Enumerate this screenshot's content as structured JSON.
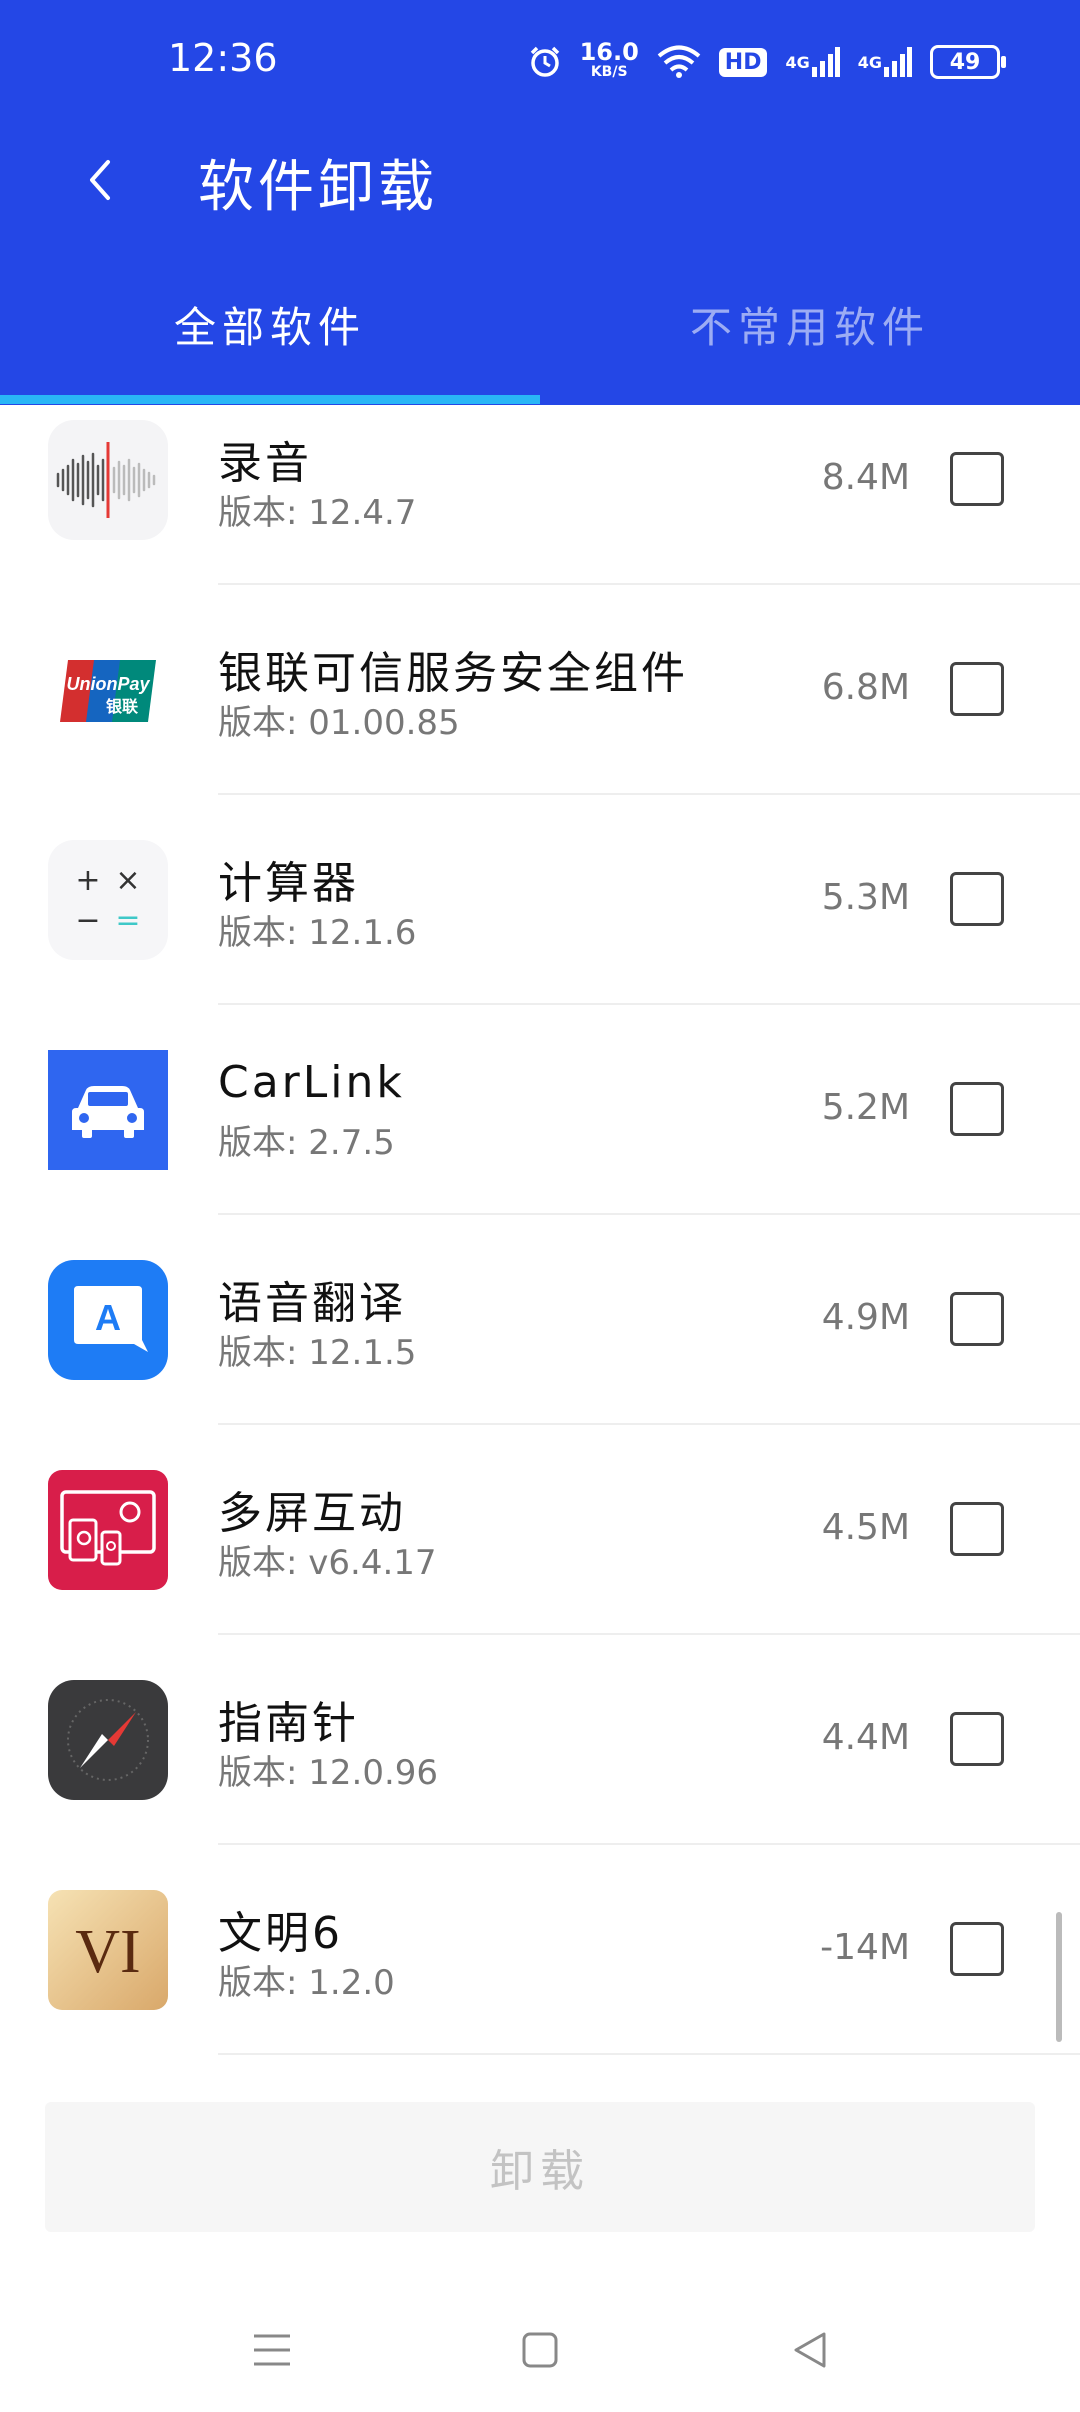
{
  "status_bar": {
    "time": "12:36",
    "speed_value": "16.0",
    "speed_unit": "KB/S",
    "hd_label": "HD",
    "net1": "4G",
    "net2": "4G",
    "battery": "49"
  },
  "header": {
    "title": "软件卸载",
    "back_icon": "chevron-left-icon"
  },
  "tabs": [
    {
      "label": "全部软件",
      "selected": true
    },
    {
      "label": "不常用软件",
      "selected": false
    }
  ],
  "apps": [
    {
      "name": "录音",
      "version": "版本: 12.4.7",
      "size": "8.4M",
      "icon": "recorder-icon",
      "checked": false
    },
    {
      "name": "银联可信服务安全组件",
      "version": "版本: 01.00.85",
      "size": "6.8M",
      "icon": "unionpay-icon",
      "checked": false
    },
    {
      "name": "计算器",
      "version": "版本: 12.1.6",
      "size": "5.3M",
      "icon": "calculator-icon",
      "checked": false
    },
    {
      "name": "CarLink",
      "version": "版本: 2.7.5",
      "size": "5.2M",
      "icon": "car-icon",
      "checked": false
    },
    {
      "name": "语音翻译",
      "version": "版本: 12.1.5",
      "size": "4.9M",
      "icon": "translate-icon",
      "checked": false
    },
    {
      "name": "多屏互动",
      "version": "版本: v6.4.17",
      "size": "4.5M",
      "icon": "multiscreen-icon",
      "checked": false
    },
    {
      "name": "指南针",
      "version": "版本: 12.0.96",
      "size": "4.4M",
      "icon": "compass-icon",
      "checked": false
    },
    {
      "name": "文明6",
      "version": "版本: 1.2.0",
      "size": "-14M",
      "icon": "civilization-icon",
      "checked": false
    }
  ],
  "icon_text": {
    "unionpay": "UnionPay",
    "unionpay_cn": "银联",
    "calc": [
      "+",
      "×",
      "−",
      "="
    ],
    "translate": "A",
    "civ": "VI"
  },
  "footer": {
    "uninstall_label": "卸载"
  },
  "colors": {
    "header_bg": "#2447e6",
    "tab_indicator": "#29b6f6"
  }
}
